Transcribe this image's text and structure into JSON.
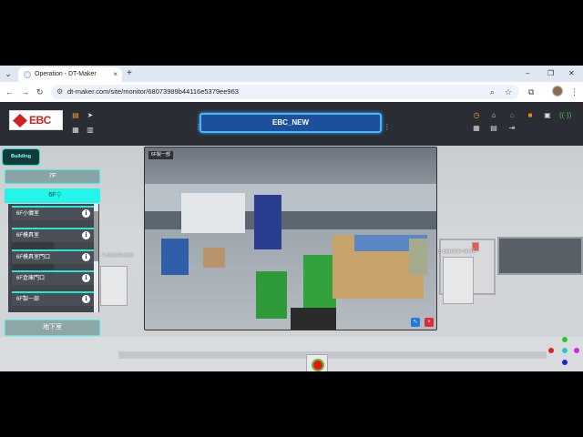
{
  "browser": {
    "tab_title": "Operation - DT-Maker",
    "tab_close": "×",
    "new_tab": "+",
    "url": "dt-maker.com/site/monitor/68073989b44116e5379ee963",
    "nav": {
      "back": "←",
      "forward": "→",
      "reload": "↻"
    },
    "window": {
      "minimize": "–",
      "maximize": "❐",
      "close": "✕"
    },
    "icons": {
      "zoom": "⌕",
      "star": "☆",
      "extensions": "⧉",
      "menu": "⋮",
      "tab_list": "⌄",
      "site_info": "⚙"
    }
  },
  "app": {
    "logo_text": "EBC",
    "header_title": "EBC_NEW",
    "accent_color": "#22f5ea",
    "title_color": "#1d4f9a"
  },
  "sidebar": {
    "building_label": "Building",
    "floor_7f": "7F",
    "floor_6f": "6F",
    "cameras": [
      {
        "label": "6F小儀室"
      },
      {
        "label": "6F模具室"
      },
      {
        "label": "6F模具室門口"
      },
      {
        "label": "6F倉庫門口"
      },
      {
        "label": "6F製一部"
      }
    ],
    "info_glyph": "i",
    "basement_label": "地下室"
  },
  "video": {
    "tag": "6F製一部",
    "expand_glyph": "↖",
    "close_glyph": "×"
  },
  "scene": {
    "label_left": "F-B20100-0001",
    "label_right": "F-B20100-0005"
  }
}
